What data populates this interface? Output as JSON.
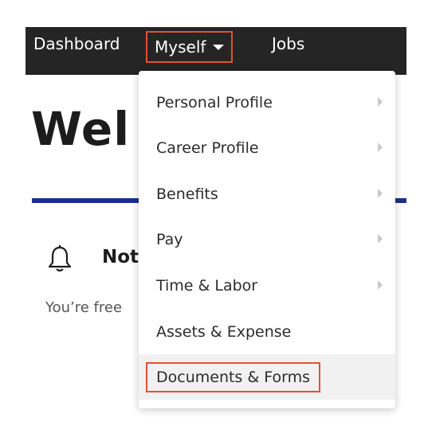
{
  "nav": {
    "dashboard": "Dashboard",
    "myself": "Myself",
    "jobs": "Jobs"
  },
  "main": {
    "welcome": "Wel",
    "notifications_title": "Not",
    "notifications_text": "You’re free"
  },
  "dropdown": {
    "items": [
      {
        "label": "Personal Profile",
        "has_submenu": true
      },
      {
        "label": "Career Profile",
        "has_submenu": true
      },
      {
        "label": "Benefits",
        "has_submenu": true
      },
      {
        "label": "Pay",
        "has_submenu": true
      },
      {
        "label": "Time & Labor",
        "has_submenu": true
      },
      {
        "label": "Assets & Expense",
        "has_submenu": false
      },
      {
        "label": "Documents & Forms",
        "has_submenu": false,
        "highlighted": true
      }
    ]
  },
  "colors": {
    "nav_bg": "#252525",
    "highlight_border": "#e0532f",
    "accent_rule": "#1b2f8c"
  }
}
